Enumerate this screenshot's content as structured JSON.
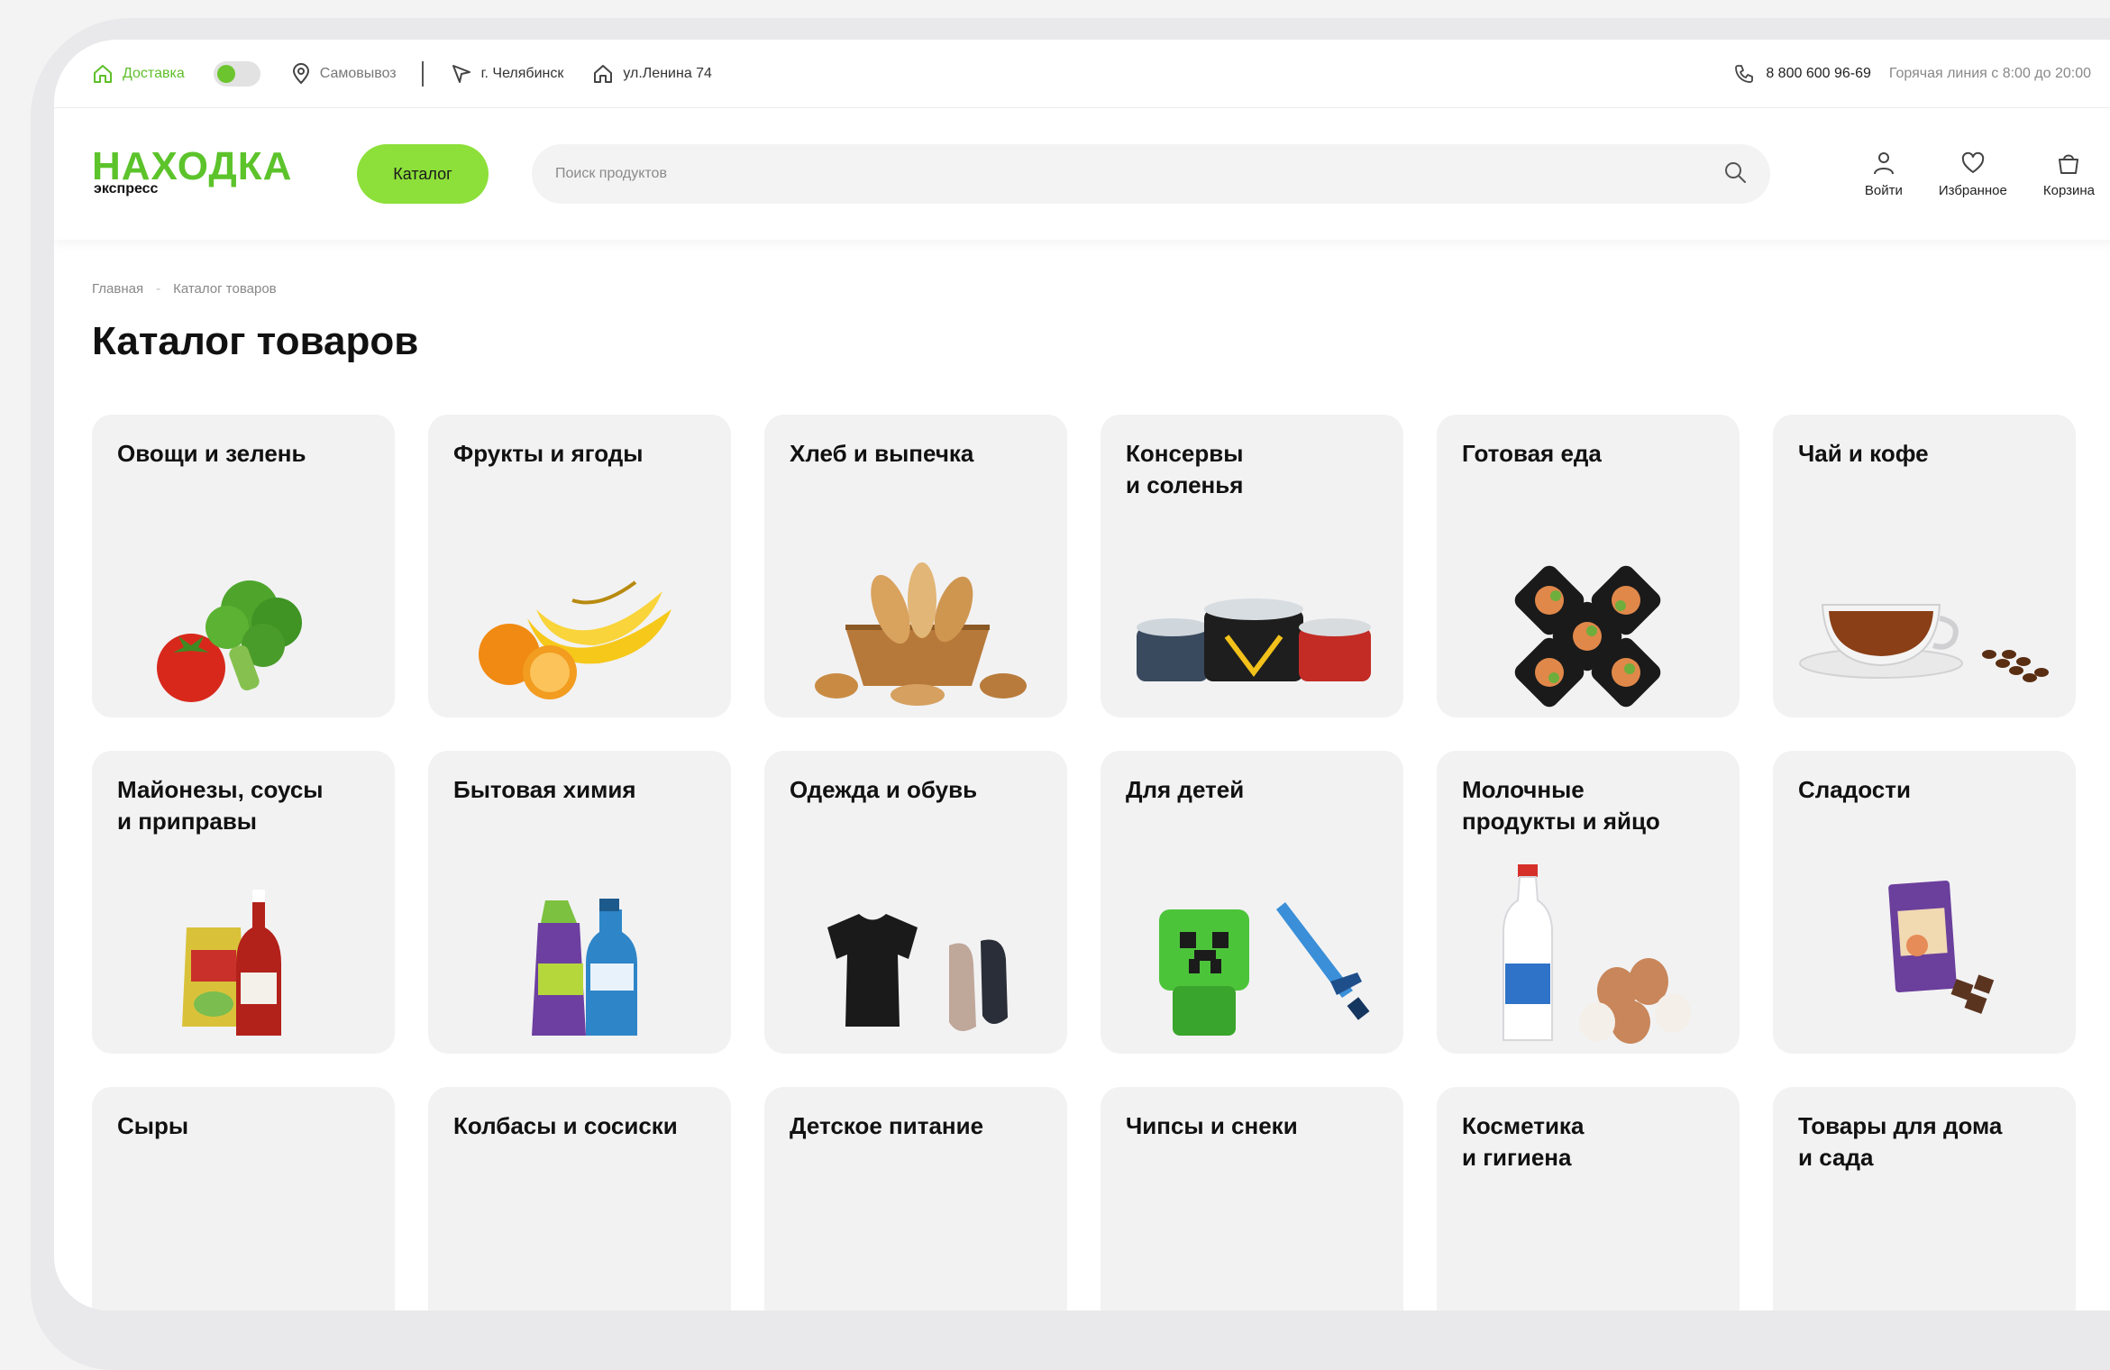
{
  "topbar": {
    "delivery_label": "Доставка",
    "pickup_label": "Самовывоз",
    "city": "г. Челябинск",
    "address": "ул.Ленина 74",
    "phone": "8 800 600 96-69",
    "hotline": "Горячая линия с 8:00 до 20:00"
  },
  "header": {
    "logo_main": "НАХОДКА",
    "logo_sub": "экспресс",
    "catalog_button": "Каталог",
    "search_placeholder": "Поиск продуктов",
    "login_label": "Войти",
    "favorites_label": "Избранное",
    "cart_label": "Корзина"
  },
  "breadcrumb": {
    "home": "Главная",
    "separator": "-",
    "current": "Каталог товаров"
  },
  "page_title": "Каталог товаров",
  "categories": [
    {
      "name": "Овощи и зелень",
      "icon": "vegetables"
    },
    {
      "name": "Фрукты и ягоды",
      "icon": "fruits"
    },
    {
      "name": "Хлеб и выпечка",
      "icon": "bread-basket"
    },
    {
      "name": "Консервы\nи соленья",
      "icon": "canned-food"
    },
    {
      "name": "Готовая еда",
      "icon": "ready-meals"
    },
    {
      "name": "Чай и кофе",
      "icon": "tea-cup"
    },
    {
      "name": "Майонезы, соусы\nи приправы",
      "icon": "sauces"
    },
    {
      "name": "Бытовая химия",
      "icon": "cleaning-bottles"
    },
    {
      "name": "Одежда и обувь",
      "icon": "tshirt-shoes"
    },
    {
      "name": "Для детей",
      "icon": "toys"
    },
    {
      "name": "Молочные\nпродукты и яйцо",
      "icon": "milk-eggs"
    },
    {
      "name": "Сладости",
      "icon": "chocolate"
    },
    {
      "name": "Сыры",
      "icon": "cheese"
    },
    {
      "name": "Колбасы и сосиски",
      "icon": "sausages"
    },
    {
      "name": "Детское питание",
      "icon": "baby-formula"
    },
    {
      "name": "Чипсы и снеки",
      "icon": "snacks"
    },
    {
      "name": "Косметика\nи гигиена",
      "icon": "cosmetics"
    },
    {
      "name": "Товары для дома\nи сада",
      "icon": "home-garden"
    }
  ],
  "colors": {
    "brand_green": "#5cc32b",
    "button_green": "#8ddf3a",
    "card_bg": "#f2f2f3"
  }
}
